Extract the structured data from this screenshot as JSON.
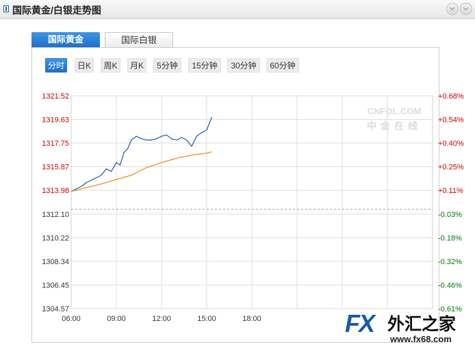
{
  "header": {
    "title": "国际黄金/白银走势图"
  },
  "tabs": [
    {
      "label": "国际黄金",
      "active": true
    },
    {
      "label": "国际白银",
      "active": false
    }
  ],
  "timeframes": [
    "分时",
    "日K",
    "周K",
    "月K",
    "5分钟",
    "15分钟",
    "30分钟",
    "60分钟"
  ],
  "watermark": {
    "latin": "CNFOL.COM",
    "chinese": "中金在线"
  },
  "logo": {
    "fx": "FX",
    "chinese": "外汇之家",
    "url": "www.fx68.com"
  },
  "colors": {
    "price_line": "#1a5aa8",
    "avg_line": "#e8a040",
    "up": "#cc0000",
    "down": "#007700",
    "accent": "#2a7fd4"
  },
  "chart_data": {
    "type": "line",
    "y_ticks": [
      "1321.52",
      "1319.63",
      "1317.75",
      "1315.87",
      "1313.98",
      "1312.10",
      "1310.22",
      "1308.34",
      "1306.45",
      "1304.57"
    ],
    "pct_ticks": [
      "+0.68%",
      "+0.54%",
      "+0.40%",
      "+0.25%",
      "+0.11%",
      "-0.03%",
      "-0.18%",
      "-0.32%",
      "-0.46%",
      "-0.61%"
    ],
    "x_ticks": [
      "06:00",
      "09:00",
      "12:00",
      "15:00",
      "18:00"
    ],
    "ylim": [
      1304.57,
      1321.52
    ],
    "x_range": [
      "06:00",
      "06:00 (+1d)"
    ],
    "reference_line": 1312.48,
    "grid": true,
    "series": [
      {
        "x": [
          "06:00",
          "06:20",
          "06:40",
          "07:00",
          "07:30",
          "08:00",
          "08:20",
          "08:40",
          "09:00",
          "09:15",
          "09:30",
          "09:45",
          "10:00",
          "10:20",
          "10:40",
          "11:00",
          "11:20",
          "11:40",
          "12:00",
          "12:20",
          "12:40",
          "13:00",
          "13:20",
          "13:40",
          "14:00",
          "14:20",
          "14:40",
          "15:00",
          "15:20"
        ],
        "values": [
          1313.9,
          1314.1,
          1314.3,
          1314.6,
          1314.9,
          1315.2,
          1315.7,
          1315.5,
          1316.2,
          1316.0,
          1317.0,
          1317.3,
          1318.0,
          1318.3,
          1318.1,
          1318.0,
          1318.0,
          1318.1,
          1318.3,
          1318.4,
          1318.1,
          1318.0,
          1318.2,
          1318.0,
          1317.5,
          1318.3,
          1318.6,
          1318.8,
          1319.8
        ]
      },
      {
        "x": [
          "06:00",
          "07:00",
          "08:00",
          "09:00",
          "10:00",
          "11:00",
          "12:00",
          "13:00",
          "14:00",
          "15:00",
          "15:20"
        ],
        "values": [
          1313.9,
          1314.2,
          1314.5,
          1314.85,
          1315.2,
          1315.8,
          1316.2,
          1316.55,
          1316.8,
          1316.95,
          1317.05
        ]
      }
    ]
  }
}
